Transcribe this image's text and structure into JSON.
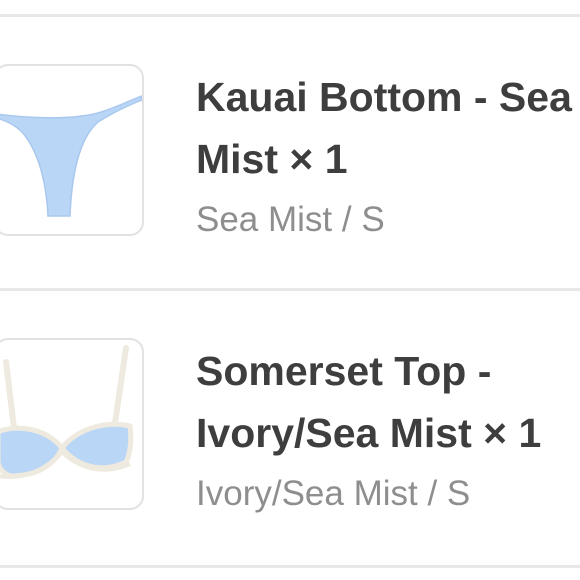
{
  "order_items": [
    {
      "title_line1": "Kauai Bottom - Sea",
      "title_line2": "Mist × 1",
      "variant": "Sea Mist / S",
      "product_color": "#b9d6f6"
    },
    {
      "title_line1": "Somerset Top -",
      "title_line2": "Ivory/Sea Mist × 1",
      "variant": "Ivory/Sea Mist / S",
      "product_color": "#b9d6f6",
      "trim_color": "#f1eee4"
    }
  ]
}
